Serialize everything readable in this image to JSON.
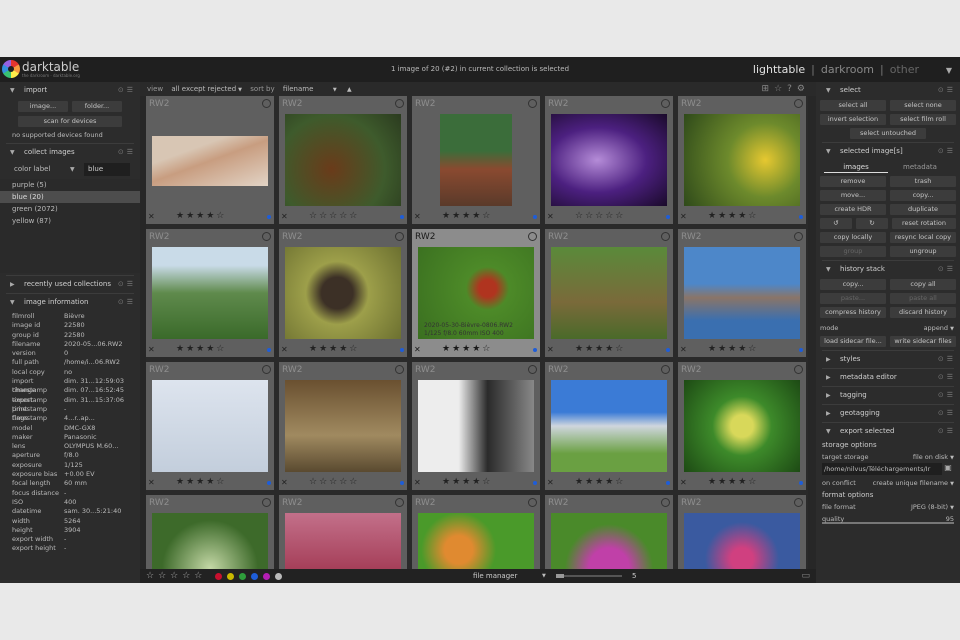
{
  "app": {
    "name": "darktable",
    "tagline": "the darkroom · darktable.org"
  },
  "collection_info": "1 image of 20 (#2) in current collection is selected",
  "views": {
    "lighttable": "lighttable",
    "darkroom": "darkroom",
    "other": "other",
    "sep": "|"
  },
  "left": {
    "import": {
      "title": "import",
      "image_btn": "image...",
      "folder_btn": "folder...",
      "scan_btn": "scan for devices",
      "no_devices": "no supported devices found"
    },
    "collect": {
      "title": "collect images",
      "field": "color label",
      "value": "blue",
      "items": [
        "purple (5)",
        "blue (20)",
        "green (2072)",
        "yellow (87)"
      ]
    },
    "recent": {
      "title": "recently used collections"
    },
    "info": {
      "title": "image information",
      "rows": [
        [
          "filmroll",
          "Bièvre"
        ],
        [
          "image id",
          "22580"
        ],
        [
          "group id",
          "22580"
        ],
        [
          "filename",
          "2020-05...06.RW2"
        ],
        [
          "version",
          "0"
        ],
        [
          "full path",
          "/home/i...06.RW2"
        ],
        [
          "local copy",
          "no"
        ],
        [
          "import timestamp",
          "dim. 31...12:59:03"
        ],
        [
          "change timestamp",
          "dim. 07...16:52:45"
        ],
        [
          "export timestamp",
          "dim. 31...15:37:06"
        ],
        [
          "print timestamp",
          "-"
        ],
        [
          "flags",
          "4...r..ap..."
        ],
        [
          "model",
          "DMC-GX8"
        ],
        [
          "maker",
          "Panasonic"
        ],
        [
          "lens",
          "OLYMPUS M.60..."
        ],
        [
          "aperture",
          "f/8.0"
        ],
        [
          "exposure",
          "1/125"
        ],
        [
          "exposure bias",
          "+0.00 EV"
        ],
        [
          "focal length",
          "60 mm"
        ],
        [
          "focus distance",
          "-"
        ],
        [
          "ISO",
          "400"
        ],
        [
          "datetime",
          "sam. 30...5:21:40"
        ],
        [
          "width",
          "5264"
        ],
        [
          "height",
          "3904"
        ],
        [
          "export width",
          "-"
        ],
        [
          "export height",
          "-"
        ]
      ]
    }
  },
  "center": {
    "view_label": "view",
    "filter": "all except rejected",
    "sort_label": "sort by",
    "sort": "filename",
    "ext": "RW2",
    "hover_caption_1": "2020-05-30-Bièvre-0806.RW2",
    "hover_caption_2": "1/125 f/8.0 60mm ISO 400",
    "layout": "file manager",
    "zoom": "5"
  },
  "right": {
    "select": {
      "title": "select",
      "all": "select all",
      "none": "select none",
      "invert": "invert selection",
      "film": "select film roll",
      "untouched": "select untouched"
    },
    "selected": {
      "title": "selected image[s]",
      "tab_images": "images",
      "tab_metadata": "metadata",
      "remove": "remove",
      "trash": "trash",
      "move": "move...",
      "copy": "copy...",
      "hdr": "create HDR",
      "duplicate": "duplicate",
      "reset": "reset rotation",
      "copy_locally": "copy locally",
      "resync": "resync local copy",
      "group": "group",
      "ungroup": "ungroup"
    },
    "history": {
      "title": "history stack",
      "copy": "copy...",
      "copy_all": "copy all",
      "paste": "paste...",
      "paste_all": "paste all",
      "compress": "compress history",
      "discard": "discard history",
      "mode_label": "mode",
      "mode_value": "append",
      "load_sidecar": "load sidecar file...",
      "write_sidecar": "write sidecar files"
    },
    "styles": "styles",
    "metadata_editor": "metadata editor",
    "tagging": "tagging",
    "geotagging": "geotagging",
    "export": {
      "title": "export selected",
      "storage_options": "storage options",
      "target_label": "target storage",
      "target_value": "file on disk",
      "path": "/home/nilvus/Téléchargements/Ir",
      "conflict_label": "on conflict",
      "conflict_value": "create unique filename",
      "format_options": "format options",
      "format_label": "file format",
      "format_value": "JPEG (8-bit)",
      "quality_label": "quality",
      "quality_value": "95"
    }
  },
  "colors": {
    "bg": "#272727",
    "panel": "#2c2c2c",
    "thumb": "#5f5f5f",
    "accent": "#1e5dd8"
  }
}
